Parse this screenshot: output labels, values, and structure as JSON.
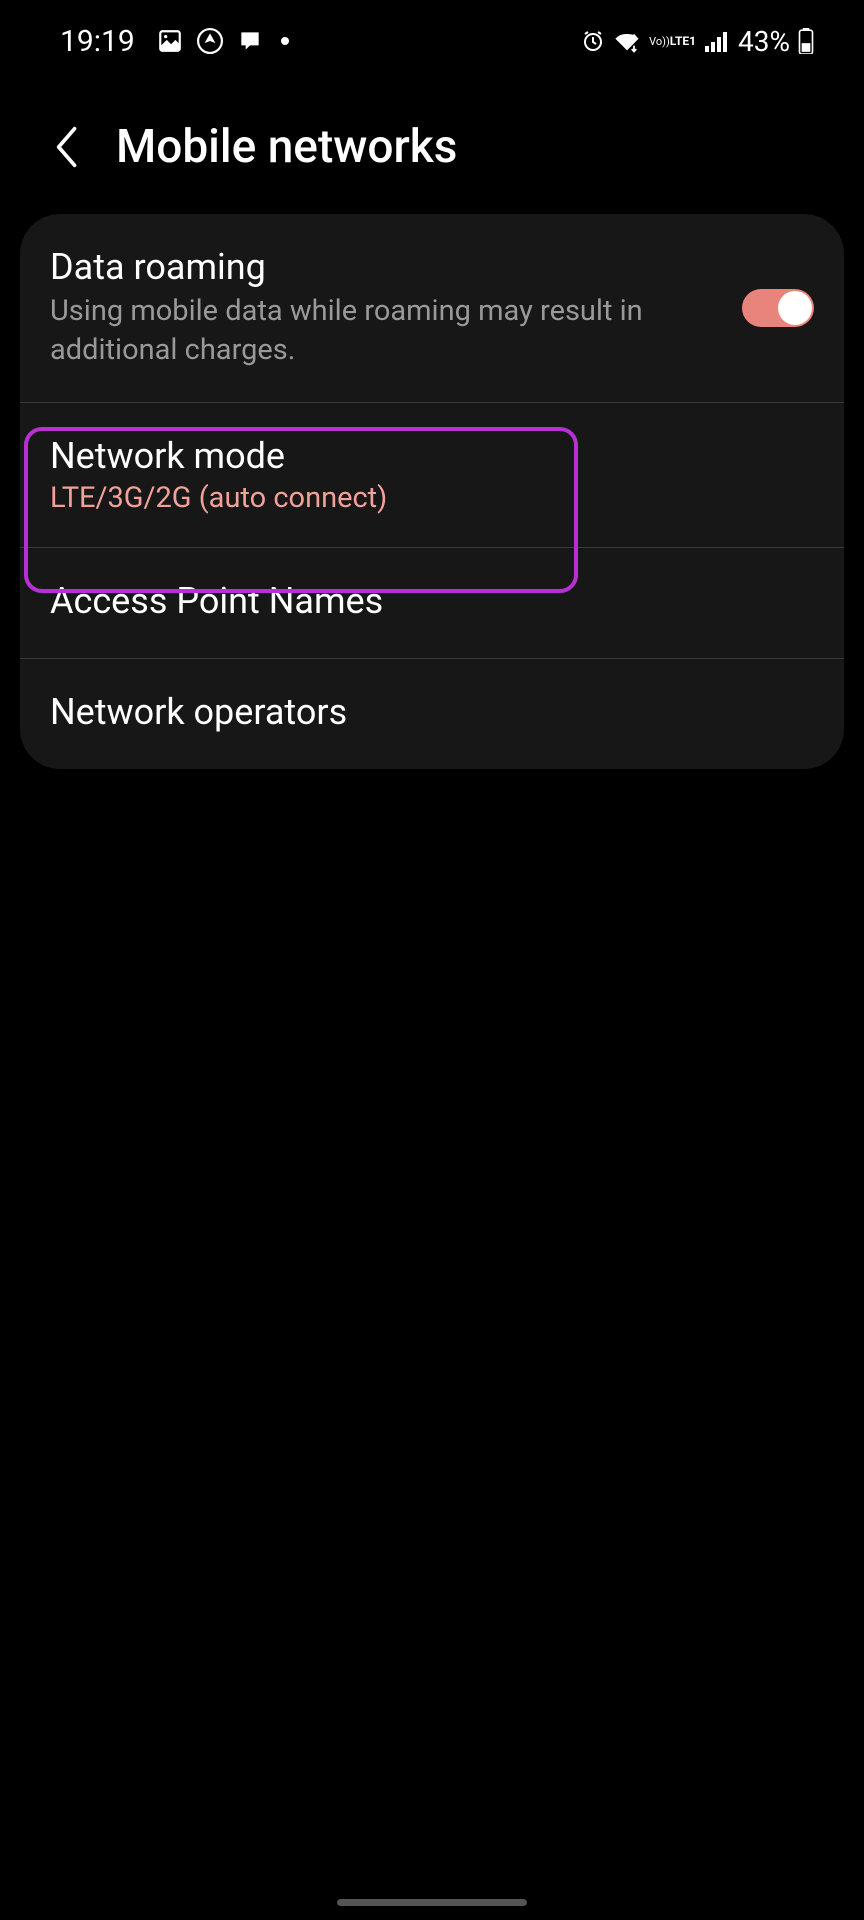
{
  "statusBar": {
    "time": "19:19",
    "battery": "43%"
  },
  "header": {
    "title": "Mobile networks"
  },
  "settings": {
    "dataRoaming": {
      "title": "Data roaming",
      "subtitle": "Using mobile data while roaming may result in additional charges.",
      "enabled": true
    },
    "networkMode": {
      "title": "Network mode",
      "value": "LTE/3G/2G (auto connect)"
    },
    "apn": {
      "title": "Access Point Names"
    },
    "networkOperators": {
      "title": "Network operators"
    }
  }
}
